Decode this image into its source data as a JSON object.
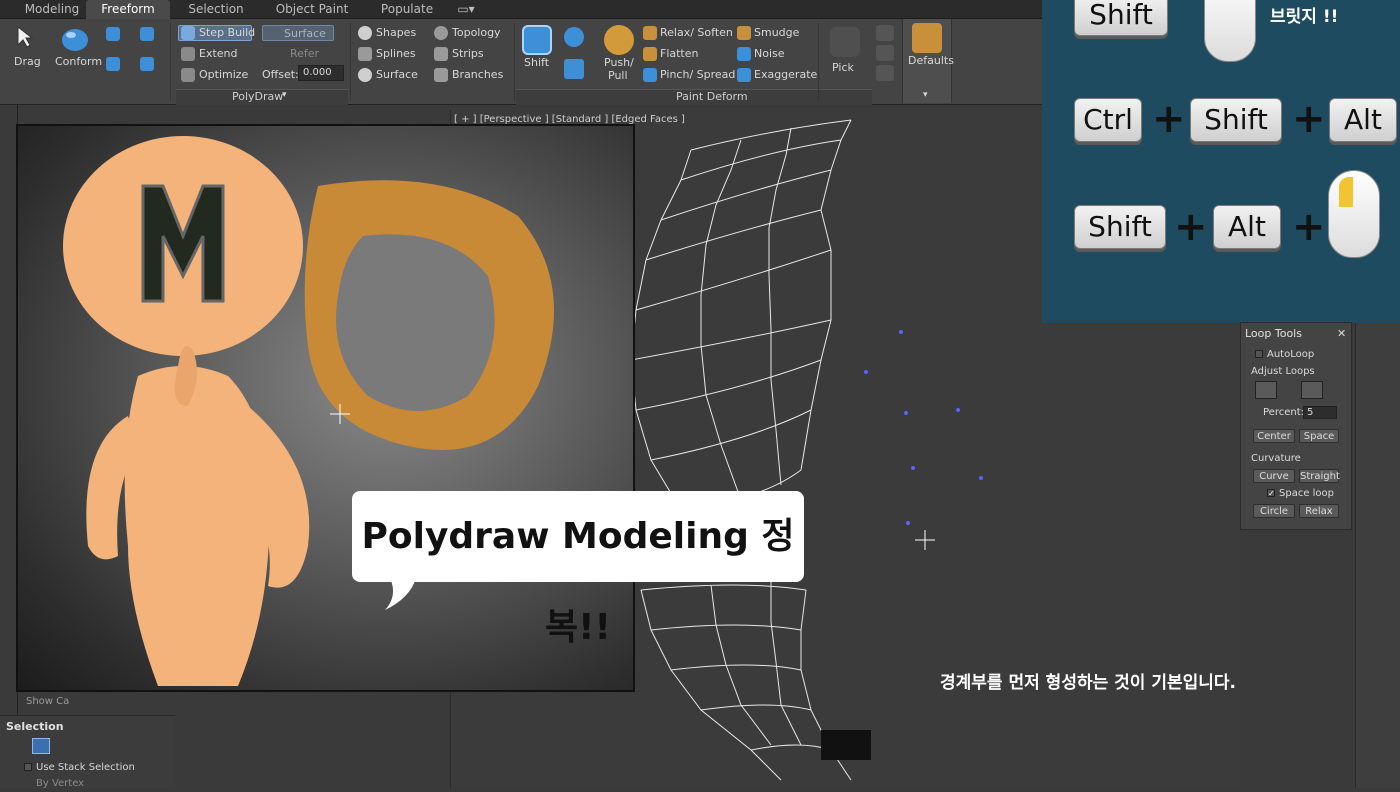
{
  "tabs": [
    "Modeling",
    "Freeform",
    "Selection",
    "Object Paint",
    "Populate"
  ],
  "ribbon": {
    "drag": "Drag",
    "conform": "Conform",
    "step_build": "Step Build",
    "extend": "Extend",
    "optimize": "Optimize",
    "surface_btn": "Surface",
    "refer": "Refer",
    "offset_label": "Offset:",
    "offset_value": "0.000",
    "polydraw_label": "PolyDraw",
    "shapes": "Shapes",
    "splines": "Splines",
    "surface": "Surface",
    "topology": "Topology",
    "strips": "Strips",
    "branches": "Branches",
    "shift": "Shift",
    "push_pull": "Push/\nPull",
    "relax_soften": "Relax/ Soften",
    "flatten": "Flatten",
    "pinch_spread": "Pinch/ Spread",
    "smudge": "Smudge",
    "noise": "Noise",
    "exaggerate": "Exaggerate",
    "pick": "Pick",
    "paint_deform_label": "Paint Deform",
    "defaults": "Defaults"
  },
  "viewport": {
    "label": "[ + ] [Perspective ] [Standard ] [Edged Faces ]"
  },
  "thumbnail": {
    "letter": "M",
    "bubble_text": "Polydraw Modeling 정복!!"
  },
  "caption": "경계부를 먼저 형성하는 것이 기본입니다.",
  "keys": {
    "row1": [
      "Shift"
    ],
    "row1_text": "브릿지 !!",
    "row2": [
      "Ctrl",
      "Shift",
      "Alt"
    ],
    "row3": [
      "Shift",
      "Alt"
    ],
    "plus": "+"
  },
  "loop_tools": {
    "title": "Loop Tools",
    "close": "✕",
    "autoloop": "AutoLoop",
    "adjust_loops": "Adjust Loops",
    "percent_label": "Percent:",
    "percent_value": "5",
    "center": "Center",
    "space": "Space",
    "curvature": "Curvature",
    "curve": "Curve",
    "straight": "Straight",
    "space_loop": "Space loop",
    "circle": "Circle",
    "relax": "Relax"
  },
  "left_panel": {
    "show_cage": "Show Ca",
    "selection": "Selection",
    "use_stack": "Use Stack Selection",
    "by_vertex": "By Vertex"
  },
  "colors": {
    "accent": "#4d7fc1",
    "key_panel": "#1f4b60"
  }
}
